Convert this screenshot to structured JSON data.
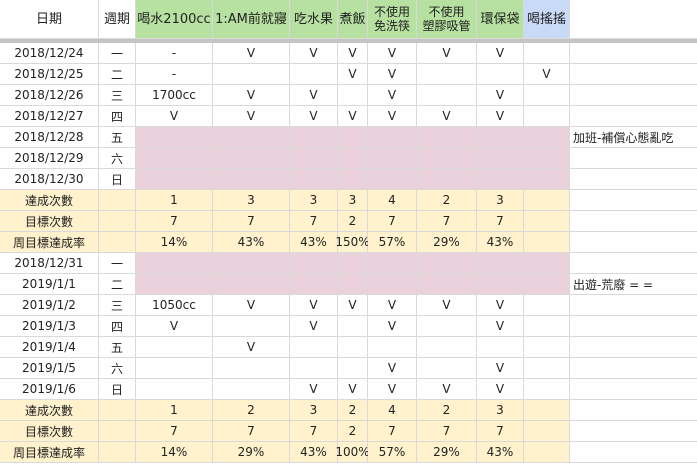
{
  "headers": [
    "日期",
    "週期",
    "喝水2100cc",
    "1:AM前就寢",
    "吃水果",
    "煮飯",
    "不使用\n免洗筷",
    "不使用\n塑膠吸管",
    "環保袋",
    "喝搖搖"
  ],
  "header_colors": {
    "green": "#b7e1a1",
    "blue": "#c9daf8",
    "pink": "#ead1dc",
    "yellow": "#fff2cc"
  },
  "rows": [
    {
      "type": "day",
      "date": "2018/12/24",
      "weekday": "一",
      "water": "-",
      "sleep": "V",
      "fruit": "V",
      "cook": "V",
      "chopsticks": "V",
      "straw": "V",
      "bag": "V",
      "boba": "",
      "note": ""
    },
    {
      "type": "day",
      "date": "2018/12/25",
      "weekday": "二",
      "water": "-",
      "sleep": "",
      "fruit": "",
      "cook": "V",
      "chopsticks": "V",
      "straw": "",
      "bag": "",
      "boba": "V",
      "note": ""
    },
    {
      "type": "day",
      "date": "2018/12/26",
      "weekday": "三",
      "water": "1700cc",
      "sleep": "V",
      "fruit": "V",
      "cook": "",
      "chopsticks": "V",
      "straw": "",
      "bag": "V",
      "boba": "",
      "note": ""
    },
    {
      "type": "day",
      "date": "2018/12/27",
      "weekday": "四",
      "water": "V",
      "sleep": "V",
      "fruit": "V",
      "cook": "V",
      "chopsticks": "V",
      "straw": "V",
      "bag": "V",
      "boba": "",
      "note": ""
    },
    {
      "type": "pink",
      "date": "2018/12/28",
      "weekday": "五",
      "water": "",
      "sleep": "",
      "fruit": "",
      "cook": "",
      "chopsticks": "",
      "straw": "",
      "bag": "",
      "boba": "",
      "note": "加班-補償心態亂吃"
    },
    {
      "type": "pink",
      "date": "2018/12/29",
      "weekday": "六",
      "water": "",
      "sleep": "",
      "fruit": "",
      "cook": "",
      "chopsticks": "",
      "straw": "",
      "bag": "",
      "boba": "",
      "note": ""
    },
    {
      "type": "pink",
      "date": "2018/12/30",
      "weekday": "日",
      "water": "",
      "sleep": "",
      "fruit": "",
      "cook": "",
      "chopsticks": "",
      "straw": "",
      "bag": "",
      "boba": "",
      "note": ""
    },
    {
      "type": "summary",
      "date": "達成次數",
      "weekday": "",
      "water": "1",
      "sleep": "3",
      "fruit": "3",
      "cook": "3",
      "chopsticks": "4",
      "straw": "2",
      "bag": "3",
      "boba": "",
      "note": ""
    },
    {
      "type": "summary",
      "date": "目標次數",
      "weekday": "",
      "water": "7",
      "sleep": "7",
      "fruit": "7",
      "cook": "2",
      "chopsticks": "7",
      "straw": "7",
      "bag": "7",
      "boba": "",
      "note": ""
    },
    {
      "type": "summary",
      "date": "周目標達成率",
      "weekday": "",
      "water": "14%",
      "sleep": "43%",
      "fruit": "43%",
      "cook": "150%",
      "chopsticks": "57%",
      "straw": "29%",
      "bag": "43%",
      "boba": "",
      "note": ""
    },
    {
      "type": "pink",
      "date": "2018/12/31",
      "weekday": "一",
      "water": "",
      "sleep": "",
      "fruit": "",
      "cook": "",
      "chopsticks": "",
      "straw": "",
      "bag": "",
      "boba": "",
      "note": ""
    },
    {
      "type": "pink",
      "date": "2019/1/1",
      "weekday": "二",
      "water": "",
      "sleep": "",
      "fruit": "",
      "cook": "",
      "chopsticks": "",
      "straw": "",
      "bag": "",
      "boba": "",
      "note": "出遊-荒廢 = ="
    },
    {
      "type": "day",
      "date": "2019/1/2",
      "weekday": "三",
      "water": "1050cc",
      "sleep": "V",
      "fruit": "V",
      "cook": "V",
      "chopsticks": "V",
      "straw": "V",
      "bag": "V",
      "boba": "",
      "note": ""
    },
    {
      "type": "day",
      "date": "2019/1/3",
      "weekday": "四",
      "water": "V",
      "sleep": "",
      "fruit": "V",
      "cook": "",
      "chopsticks": "V",
      "straw": "",
      "bag": "V",
      "boba": "",
      "note": ""
    },
    {
      "type": "day",
      "date": "2019/1/4",
      "weekday": "五",
      "water": "",
      "sleep": "V",
      "fruit": "",
      "cook": "",
      "chopsticks": "",
      "straw": "",
      "bag": "",
      "boba": "",
      "note": ""
    },
    {
      "type": "day",
      "date": "2019/1/5",
      "weekday": "六",
      "water": "",
      "sleep": "",
      "fruit": "",
      "cook": "",
      "chopsticks": "V",
      "straw": "",
      "bag": "V",
      "boba": "",
      "note": ""
    },
    {
      "type": "day",
      "date": "2019/1/6",
      "weekday": "日",
      "water": "",
      "sleep": "",
      "fruit": "V",
      "cook": "V",
      "chopsticks": "V",
      "straw": "V",
      "bag": "V",
      "boba": "",
      "note": ""
    },
    {
      "type": "summary",
      "date": "達成次數",
      "weekday": "",
      "water": "1",
      "sleep": "2",
      "fruit": "3",
      "cook": "2",
      "chopsticks": "4",
      "straw": "2",
      "bag": "3",
      "boba": "",
      "note": ""
    },
    {
      "type": "summary",
      "date": "目標次數",
      "weekday": "",
      "water": "7",
      "sleep": "7",
      "fruit": "7",
      "cook": "2",
      "chopsticks": "7",
      "straw": "7",
      "bag": "7",
      "boba": "",
      "note": ""
    },
    {
      "type": "summary",
      "date": "周目標達成率",
      "weekday": "",
      "water": "14%",
      "sleep": "29%",
      "fruit": "43%",
      "cook": "100%",
      "chopsticks": "57%",
      "straw": "29%",
      "bag": "43%",
      "boba": "",
      "note": ""
    }
  ]
}
